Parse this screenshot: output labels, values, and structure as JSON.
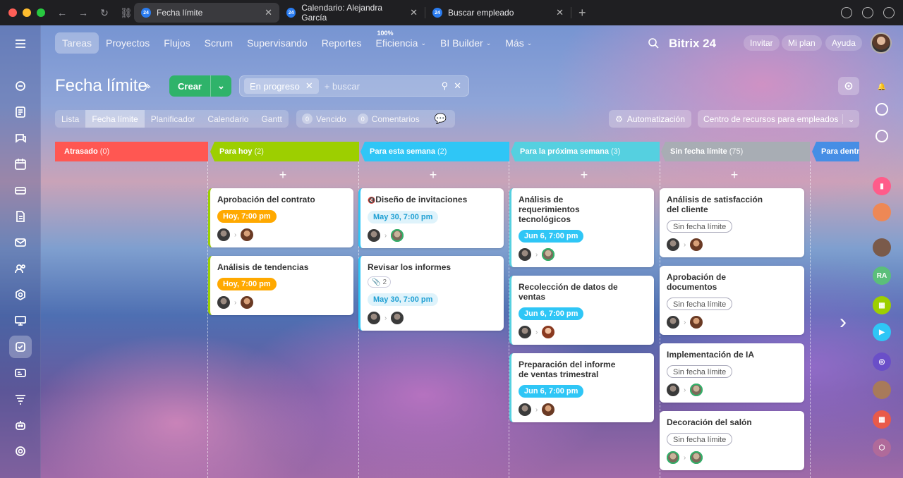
{
  "browser": {
    "tabs": [
      {
        "title": "Fecha límite",
        "active": true
      },
      {
        "title": "Calendario: Alejandra García",
        "active": false
      },
      {
        "title": "Buscar empleado",
        "active": false
      }
    ],
    "favicon_text": "24"
  },
  "topnav": {
    "items": [
      "Tareas",
      "Proyectos",
      "Flujos",
      "Scrum",
      "Supervisando",
      "Reportes",
      "Eficiencia",
      "BI Builder",
      "Más"
    ],
    "efficiency_badge": "100%",
    "brand": "Bitrix 24",
    "invite": "Invitar",
    "my_plan": "Mi plan",
    "help": "Ayuda"
  },
  "page": {
    "title": "Fecha límite",
    "create_label": "Crear",
    "filter_chip": "En progreso",
    "search_placeholder": "+ buscar"
  },
  "views": {
    "tabs": [
      "Lista",
      "Fecha límite",
      "Planificador",
      "Calendario",
      "Gantt"
    ],
    "active": "Fecha límite",
    "counters": [
      {
        "count": "0",
        "label": "Vencido"
      },
      {
        "count": "0",
        "label": "Comentarios"
      }
    ],
    "automation": "Automatización",
    "resource_center": "Centro de recursos para empleados"
  },
  "columns": [
    {
      "title": "Atrasado",
      "count": "(0)",
      "color": "#ff5752"
    },
    {
      "title": "Para hoy",
      "count": "(2)",
      "color": "#9dcf00"
    },
    {
      "title": "Para esta semana",
      "count": "(2)",
      "color": "#2fc6f6"
    },
    {
      "title": "Para la próxima semana",
      "count": "(3)",
      "color": "#55d0e0"
    },
    {
      "title": "Sin fecha límite",
      "count": "(75)",
      "color": "#a8adb4"
    },
    {
      "title": "Para dentr",
      "count": "",
      "color": "#468ee5"
    }
  ],
  "cards": {
    "c1": {
      "title": "Aprobación del contrato",
      "deadline": "Hoy, 7:00 pm"
    },
    "c2": {
      "title": "Análisis de tendencias",
      "deadline": "Hoy, 7:00 pm"
    },
    "c3": {
      "title": "Diseño de invitaciones",
      "deadline": "May 30, 7:00 pm"
    },
    "c4": {
      "title": "Revisar los informes",
      "attachments": "2",
      "deadline": "May 30, 7:00 pm"
    },
    "c5": {
      "title": "Análisis de requerimientos tecnológicos",
      "deadline": "Jun 6, 7:00 pm"
    },
    "c6": {
      "title": "Recolección de datos de ventas",
      "deadline": "Jun 6, 7:00 pm"
    },
    "c7": {
      "title": "Preparación del informe de ventas trimestral",
      "deadline": "Jun 6, 7:00 pm"
    },
    "c8": {
      "title": "Análisis de satisfacción del cliente",
      "deadline": "Sin fecha límite"
    },
    "c9": {
      "title": "Aprobación de documentos",
      "deadline": "Sin fecha límite"
    },
    "c10": {
      "title": "Implementación de IA",
      "deadline": "Sin fecha límite"
    },
    "c11": {
      "title": "Decoración del salón",
      "deadline": "Sin fecha límite"
    }
  },
  "rightbar": {
    "initials": "RA"
  }
}
